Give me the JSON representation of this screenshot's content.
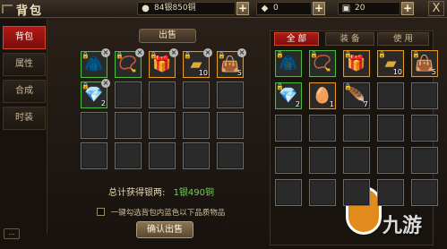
{
  "window": {
    "title": "背包",
    "close": "X"
  },
  "currency": {
    "silver": {
      "icon": "coin-icon",
      "value": "84银850铜"
    },
    "diamond": {
      "icon": "diamond-icon",
      "value": "0"
    },
    "bag": {
      "icon": "box-icon",
      "value": "20"
    }
  },
  "sidebar": {
    "items": [
      {
        "label": "背包",
        "active": true
      },
      {
        "label": "属性",
        "active": false
      },
      {
        "label": "合成",
        "active": false
      },
      {
        "label": "时装",
        "active": false
      }
    ],
    "bottom": "..."
  },
  "sell": {
    "tab": "出售",
    "slots": [
      {
        "rarity": "green",
        "icon": "cloak-icon",
        "locked": true,
        "removable": true,
        "count": ""
      },
      {
        "rarity": "green",
        "icon": "amulet-icon",
        "locked": true,
        "removable": true,
        "count": ""
      },
      {
        "rarity": "orange",
        "icon": "chest-icon",
        "locked": true,
        "removable": true,
        "count": ""
      },
      {
        "rarity": "orange",
        "icon": "gold-bar-icon",
        "locked": true,
        "removable": true,
        "count": "10"
      },
      {
        "rarity": "orange",
        "icon": "bag-icon",
        "locked": true,
        "removable": true,
        "count": "5"
      },
      {
        "rarity": "green",
        "icon": "crystal-icon",
        "locked": true,
        "removable": true,
        "count": "2"
      }
    ],
    "total_label": "总计获得银两:",
    "total_value": "1银490铜",
    "auto_select_label": "一键勾选背包内蓝色以下品质物品",
    "confirm_label": "确认出售"
  },
  "inventory": {
    "tabs": [
      {
        "label": "全 部",
        "active": true
      },
      {
        "label": "装 备",
        "active": false
      },
      {
        "label": "使 用",
        "active": false
      }
    ],
    "slots": [
      {
        "rarity": "green",
        "icon": "cloak-icon",
        "locked": true,
        "count": ""
      },
      {
        "rarity": "green",
        "icon": "amulet-icon",
        "locked": true,
        "count": ""
      },
      {
        "rarity": "orange",
        "icon": "chest-icon",
        "locked": true,
        "count": ""
      },
      {
        "rarity": "orange",
        "icon": "gold-bar-icon",
        "locked": true,
        "count": "10"
      },
      {
        "rarity": "orange",
        "icon": "bag-icon",
        "locked": true,
        "count": "5"
      },
      {
        "rarity": "green",
        "icon": "crystal-icon",
        "locked": true,
        "count": "2"
      },
      {
        "rarity": "orange",
        "icon": "egg-icon",
        "locked": false,
        "count": "1"
      },
      {
        "rarity": "gray",
        "icon": "feather-icon",
        "locked": true,
        "count": "7"
      }
    ]
  },
  "watermark": "九游"
}
